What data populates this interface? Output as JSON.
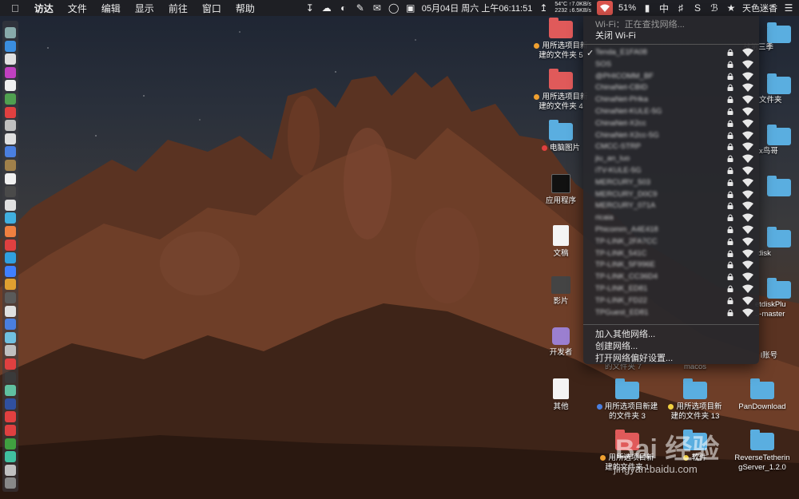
{
  "menubar": {
    "app_name": "访达",
    "menus": [
      "文件",
      "编辑",
      "显示",
      "前往",
      "窗口",
      "帮助"
    ],
    "datetime": "05月04日 周六 上午06:11:51",
    "temp": "54°C",
    "net_up": "↑7.0KB/s",
    "fan": "2232",
    "net_down": "↓6.5KB/s",
    "battery": "51%",
    "input_method": "中",
    "user": "天色迷香"
  },
  "wifi_menu": {
    "status": "Wi-Fi：正在查找网络...",
    "toggle": "关闭 Wi-Fi",
    "networks": [
      "Tenda_E1FA08",
      "SOS",
      "@PHICOMM_BF",
      "ChinaNet-CBID",
      "ChinaNet-PHka",
      "ChinaNet-KULE-5G",
      "ChinaNet-X2cc",
      "ChinaNet-X2cc-5G",
      "CMCC-STRP",
      "jiu_an_luo",
      "iTV-KULE-5G",
      "MERCURY_503",
      "MERCURY_D0C9",
      "MERCURY_071A",
      "ricaia",
      "Phicomm_A4E418",
      "TP-LINK_2FA7CC",
      "TP-LINK_541C",
      "TP-LINK_5F996E",
      "TP-LINK_CC36D4",
      "TP-LINK_ED81",
      "TP-LINK_FD22",
      "TPGuest_ED81"
    ],
    "join_other": "加入其他网络...",
    "create": "创建网络...",
    "prefs": "打开网络偏好设置..."
  },
  "desktop": {
    "icons": [
      {
        "label1": "用所选项目新",
        "label2": "建的文件夹 5",
        "tag": "#f0a030",
        "color": "#e05a5a"
      },
      {
        "label1": "用所选项目新",
        "label2": "建的文件夹 4",
        "tag": "#f0a030",
        "color": "#e05a5a"
      },
      {
        "label1": "电脑图片",
        "label2": "",
        "tag": "#e04040",
        "color": "#5aaee0"
      },
      {
        "label1": "应用程序",
        "label2": "",
        "tag": "",
        "color": "#222"
      },
      {
        "label1": "文稿",
        "label2": "",
        "tag": "",
        "color": "doc"
      },
      {
        "label1": "影片",
        "label2": "",
        "tag": "",
        "color": "#444"
      },
      {
        "label1": "开发者",
        "label2": "",
        "tag": "",
        "color": "#9b7fd0"
      },
      {
        "label1": "其他",
        "label2": "",
        "tag": "",
        "color": "doc"
      }
    ],
    "right_icons": [
      {
        "label": "战第三季"
      },
      {
        "label": "文件夹"
      },
      {
        "label": "x鸟哥"
      },
      {
        "label": "disk"
      },
      {
        "label1": "etdiskPlu",
        "label2": "..-master"
      },
      {
        "label": "l账号"
      }
    ],
    "bottom_row": [
      {
        "label1": "用所选项目新建",
        "label2": "的文件夹 3",
        "tag": "#4a7fe0"
      },
      {
        "label1": "用所选项目新",
        "label2": "建的文件夹 13",
        "tag": "#f0d040"
      },
      {
        "label1": "PanDownload",
        "label2": "",
        "tag": ""
      }
    ],
    "hidden_labels": [
      "的文件夹 7",
      "macos"
    ],
    "bottom_row2": [
      {
        "label1": "用所选项目新",
        "label2": "建的文件夹 1",
        "tag": "#f0a030"
      },
      {
        "label1": "软件",
        "label2": "",
        "tag": "#f0d040"
      },
      {
        "label1": "ReverseTetherin",
        "label2": "gServer_1.2.0",
        "tag": ""
      }
    ]
  },
  "watermark": {
    "text": "Bai 经验",
    "url": "jingyan.baidu.com"
  },
  "colors": {
    "wifi_highlight": "#d9544d",
    "menu_bg": "#28282c"
  }
}
